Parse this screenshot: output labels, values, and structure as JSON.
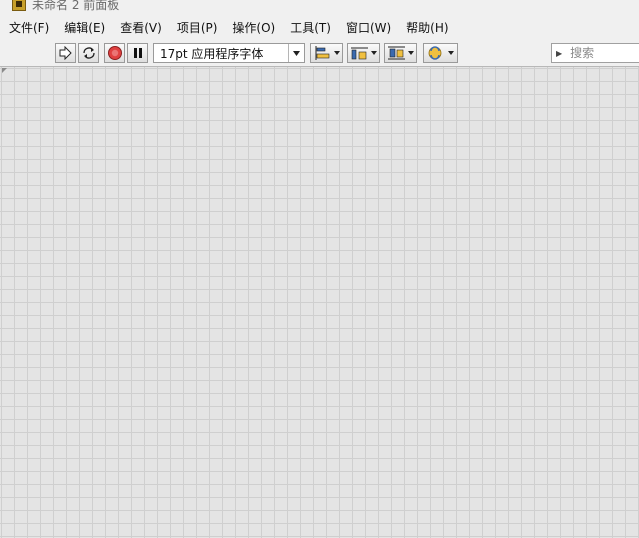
{
  "window": {
    "title": "未命名 2 前面板"
  },
  "menu": {
    "items": [
      {
        "label": "文件(F)"
      },
      {
        "label": "编辑(E)"
      },
      {
        "label": "查看(V)"
      },
      {
        "label": "项目(P)"
      },
      {
        "label": "操作(O)"
      },
      {
        "label": "工具(T)"
      },
      {
        "label": "窗口(W)"
      },
      {
        "label": "帮助(H)"
      }
    ]
  },
  "toolbar": {
    "font": {
      "label": "17pt 应用程序字体"
    },
    "search": {
      "placeholder": "搜索"
    },
    "icons": [
      "run-arrow-icon",
      "run-continuously-icon",
      "abort-icon",
      "pause-icon",
      "align-objects-icon",
      "distribute-objects-icon",
      "resize-objects-icon",
      "reorder-icon"
    ]
  },
  "colors": {
    "abort": "#e04040",
    "grid_line": "#cfcfcf",
    "panel_bg": "#e4e4e4"
  }
}
